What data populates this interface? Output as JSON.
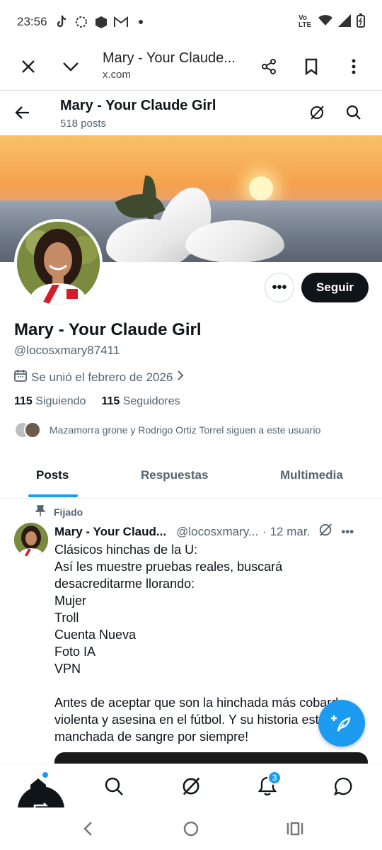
{
  "status_bar": {
    "time": "23:56",
    "network": "Vo LTE"
  },
  "browser": {
    "title": "Mary - Your Claude...",
    "url": "x.com"
  },
  "profile_header": {
    "name": "Mary - Your Claude Girl",
    "posts": "518 posts"
  },
  "profile": {
    "name": "Mary - Your Claude Girl",
    "handle": "@locosxmary87411",
    "joined": "Se unió el febrero de 2026",
    "following_count": "115",
    "following_label": "Siguiendo",
    "followers_count": "115",
    "followers_label": "Seguidores",
    "followed_by": "Mazamorra grone y Rodrigo Ortiz Torrel siguen a este usuario",
    "more_label": "•••",
    "follow_label": "Seguir"
  },
  "tabs": [
    {
      "label": "Posts",
      "active": true
    },
    {
      "label": "Respuestas",
      "active": false
    },
    {
      "label": "Multimedia",
      "active": false
    }
  ],
  "tweet": {
    "pinned_label": "Fijado",
    "author": "Mary - Your Claud...",
    "handle": "@locosxmary...",
    "date": "· 12 mar.",
    "more": "•••",
    "lines": [
      "Clásicos hinchas de la U:",
      "Así les muestre pruebas reales, buscará",
      "desacreditarme llorando:",
      "Mujer",
      "Troll",
      "Cuenta Nueva",
      "Foto IA",
      "VPN",
      "",
      "Antes de aceptar que son la hinchada más cobarde",
      "violenta y asesina en el fútbol. Y su historia está",
      "manchada de sangre por siempre!"
    ]
  },
  "bottom_nav": {
    "notifications_badge": "3"
  },
  "colors": {
    "accent": "#1d9bf0",
    "text": "#0f1419",
    "muted": "#536471"
  }
}
